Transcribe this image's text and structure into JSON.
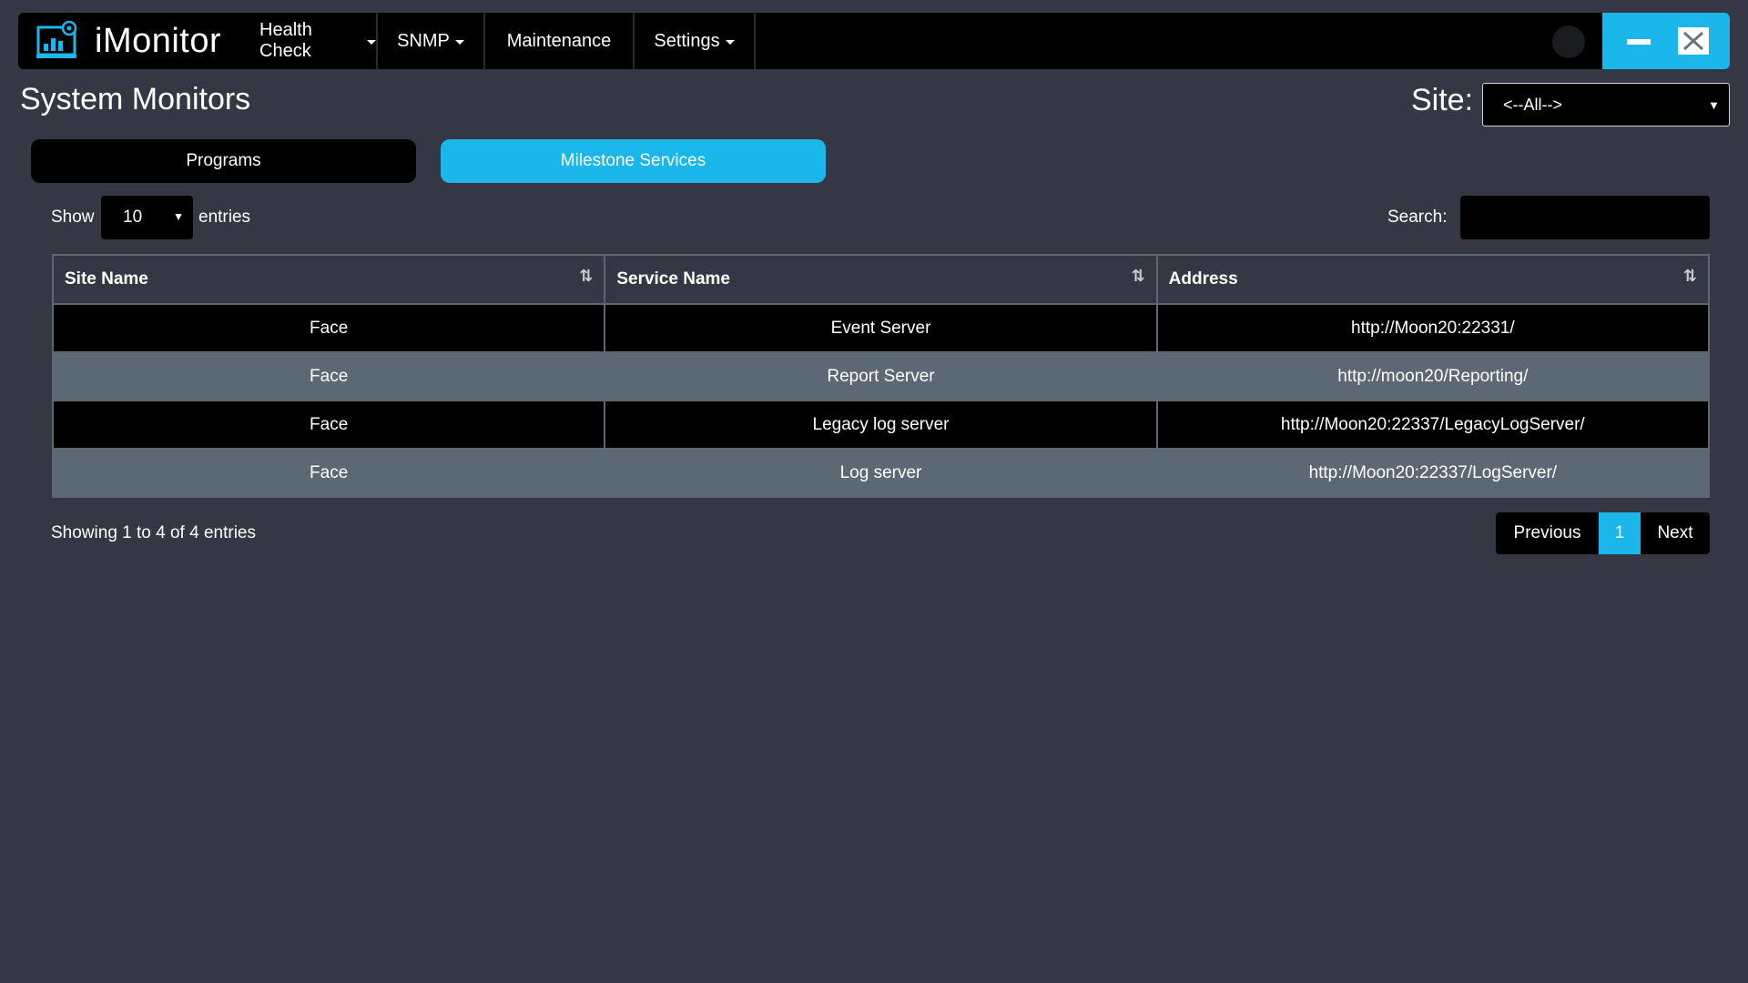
{
  "app": {
    "name": "iMonitor"
  },
  "nav": {
    "items": [
      {
        "label": "Health Check",
        "has_dropdown": true
      },
      {
        "label": "SNMP",
        "has_dropdown": true
      },
      {
        "label": "Maintenance",
        "has_dropdown": false
      },
      {
        "label": "Settings",
        "has_dropdown": true
      }
    ]
  },
  "window": {
    "theme_icon": "moon-icon",
    "minimize_icon": "minimize-icon",
    "close_icon": "close-icon"
  },
  "page": {
    "title": "System Monitors",
    "site_label": "Site:",
    "site_value": "<--All-->"
  },
  "tabs": [
    {
      "label": "Programs",
      "active": false
    },
    {
      "label": "Milestone Services",
      "active": true
    }
  ],
  "controls": {
    "show_label": "Show",
    "page_length": "10",
    "entries_label": "entries",
    "search_label": "Search:",
    "search_value": ""
  },
  "table": {
    "columns": [
      "Site Name",
      "Service Name",
      "Address"
    ],
    "rows": [
      [
        "Face",
        "Event Server",
        "http://Moon20:22331/"
      ],
      [
        "Face",
        "Report Server",
        "http://moon20/Reporting/"
      ],
      [
        "Face",
        "Legacy log server",
        "http://Moon20:22337/LegacyLogServer/"
      ],
      [
        "Face",
        "Log server",
        "http://Moon20:22337/LogServer/"
      ]
    ]
  },
  "footer": {
    "info": "Showing 1 to 4 of 4 entries",
    "previous": "Previous",
    "current_page": "1",
    "next": "Next"
  },
  "colors": {
    "background": "#353844",
    "accent": "#1bb6ea",
    "row_light": "#5c6974",
    "row_dark": "#000000"
  }
}
